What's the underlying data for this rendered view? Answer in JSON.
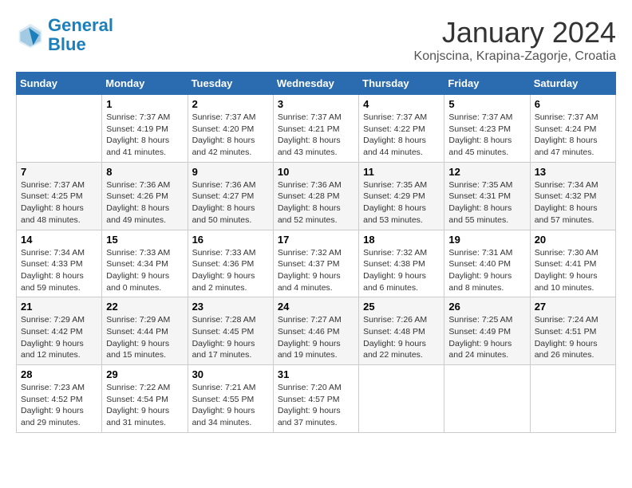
{
  "header": {
    "logo_general": "General",
    "logo_blue": "Blue",
    "title": "January 2024",
    "subtitle": "Konjscina, Krapina-Zagorje, Croatia"
  },
  "weekdays": [
    "Sunday",
    "Monday",
    "Tuesday",
    "Wednesday",
    "Thursday",
    "Friday",
    "Saturday"
  ],
  "weeks": [
    [
      {
        "day": "",
        "sunrise": "",
        "sunset": "",
        "daylight": ""
      },
      {
        "day": "1",
        "sunrise": "Sunrise: 7:37 AM",
        "sunset": "Sunset: 4:19 PM",
        "daylight": "Daylight: 8 hours and 41 minutes."
      },
      {
        "day": "2",
        "sunrise": "Sunrise: 7:37 AM",
        "sunset": "Sunset: 4:20 PM",
        "daylight": "Daylight: 8 hours and 42 minutes."
      },
      {
        "day": "3",
        "sunrise": "Sunrise: 7:37 AM",
        "sunset": "Sunset: 4:21 PM",
        "daylight": "Daylight: 8 hours and 43 minutes."
      },
      {
        "day": "4",
        "sunrise": "Sunrise: 7:37 AM",
        "sunset": "Sunset: 4:22 PM",
        "daylight": "Daylight: 8 hours and 44 minutes."
      },
      {
        "day": "5",
        "sunrise": "Sunrise: 7:37 AM",
        "sunset": "Sunset: 4:23 PM",
        "daylight": "Daylight: 8 hours and 45 minutes."
      },
      {
        "day": "6",
        "sunrise": "Sunrise: 7:37 AM",
        "sunset": "Sunset: 4:24 PM",
        "daylight": "Daylight: 8 hours and 47 minutes."
      }
    ],
    [
      {
        "day": "7",
        "sunrise": "Sunrise: 7:37 AM",
        "sunset": "Sunset: 4:25 PM",
        "daylight": "Daylight: 8 hours and 48 minutes."
      },
      {
        "day": "8",
        "sunrise": "Sunrise: 7:36 AM",
        "sunset": "Sunset: 4:26 PM",
        "daylight": "Daylight: 8 hours and 49 minutes."
      },
      {
        "day": "9",
        "sunrise": "Sunrise: 7:36 AM",
        "sunset": "Sunset: 4:27 PM",
        "daylight": "Daylight: 8 hours and 50 minutes."
      },
      {
        "day": "10",
        "sunrise": "Sunrise: 7:36 AM",
        "sunset": "Sunset: 4:28 PM",
        "daylight": "Daylight: 8 hours and 52 minutes."
      },
      {
        "day": "11",
        "sunrise": "Sunrise: 7:35 AM",
        "sunset": "Sunset: 4:29 PM",
        "daylight": "Daylight: 8 hours and 53 minutes."
      },
      {
        "day": "12",
        "sunrise": "Sunrise: 7:35 AM",
        "sunset": "Sunset: 4:31 PM",
        "daylight": "Daylight: 8 hours and 55 minutes."
      },
      {
        "day": "13",
        "sunrise": "Sunrise: 7:34 AM",
        "sunset": "Sunset: 4:32 PM",
        "daylight": "Daylight: 8 hours and 57 minutes."
      }
    ],
    [
      {
        "day": "14",
        "sunrise": "Sunrise: 7:34 AM",
        "sunset": "Sunset: 4:33 PM",
        "daylight": "Daylight: 8 hours and 59 minutes."
      },
      {
        "day": "15",
        "sunrise": "Sunrise: 7:33 AM",
        "sunset": "Sunset: 4:34 PM",
        "daylight": "Daylight: 9 hours and 0 minutes."
      },
      {
        "day": "16",
        "sunrise": "Sunrise: 7:33 AM",
        "sunset": "Sunset: 4:36 PM",
        "daylight": "Daylight: 9 hours and 2 minutes."
      },
      {
        "day": "17",
        "sunrise": "Sunrise: 7:32 AM",
        "sunset": "Sunset: 4:37 PM",
        "daylight": "Daylight: 9 hours and 4 minutes."
      },
      {
        "day": "18",
        "sunrise": "Sunrise: 7:32 AM",
        "sunset": "Sunset: 4:38 PM",
        "daylight": "Daylight: 9 hours and 6 minutes."
      },
      {
        "day": "19",
        "sunrise": "Sunrise: 7:31 AM",
        "sunset": "Sunset: 4:40 PM",
        "daylight": "Daylight: 9 hours and 8 minutes."
      },
      {
        "day": "20",
        "sunrise": "Sunrise: 7:30 AM",
        "sunset": "Sunset: 4:41 PM",
        "daylight": "Daylight: 9 hours and 10 minutes."
      }
    ],
    [
      {
        "day": "21",
        "sunrise": "Sunrise: 7:29 AM",
        "sunset": "Sunset: 4:42 PM",
        "daylight": "Daylight: 9 hours and 12 minutes."
      },
      {
        "day": "22",
        "sunrise": "Sunrise: 7:29 AM",
        "sunset": "Sunset: 4:44 PM",
        "daylight": "Daylight: 9 hours and 15 minutes."
      },
      {
        "day": "23",
        "sunrise": "Sunrise: 7:28 AM",
        "sunset": "Sunset: 4:45 PM",
        "daylight": "Daylight: 9 hours and 17 minutes."
      },
      {
        "day": "24",
        "sunrise": "Sunrise: 7:27 AM",
        "sunset": "Sunset: 4:46 PM",
        "daylight": "Daylight: 9 hours and 19 minutes."
      },
      {
        "day": "25",
        "sunrise": "Sunrise: 7:26 AM",
        "sunset": "Sunset: 4:48 PM",
        "daylight": "Daylight: 9 hours and 22 minutes."
      },
      {
        "day": "26",
        "sunrise": "Sunrise: 7:25 AM",
        "sunset": "Sunset: 4:49 PM",
        "daylight": "Daylight: 9 hours and 24 minutes."
      },
      {
        "day": "27",
        "sunrise": "Sunrise: 7:24 AM",
        "sunset": "Sunset: 4:51 PM",
        "daylight": "Daylight: 9 hours and 26 minutes."
      }
    ],
    [
      {
        "day": "28",
        "sunrise": "Sunrise: 7:23 AM",
        "sunset": "Sunset: 4:52 PM",
        "daylight": "Daylight: 9 hours and 29 minutes."
      },
      {
        "day": "29",
        "sunrise": "Sunrise: 7:22 AM",
        "sunset": "Sunset: 4:54 PM",
        "daylight": "Daylight: 9 hours and 31 minutes."
      },
      {
        "day": "30",
        "sunrise": "Sunrise: 7:21 AM",
        "sunset": "Sunset: 4:55 PM",
        "daylight": "Daylight: 9 hours and 34 minutes."
      },
      {
        "day": "31",
        "sunrise": "Sunrise: 7:20 AM",
        "sunset": "Sunset: 4:57 PM",
        "daylight": "Daylight: 9 hours and 37 minutes."
      },
      {
        "day": "",
        "sunrise": "",
        "sunset": "",
        "daylight": ""
      },
      {
        "day": "",
        "sunrise": "",
        "sunset": "",
        "daylight": ""
      },
      {
        "day": "",
        "sunrise": "",
        "sunset": "",
        "daylight": ""
      }
    ]
  ]
}
